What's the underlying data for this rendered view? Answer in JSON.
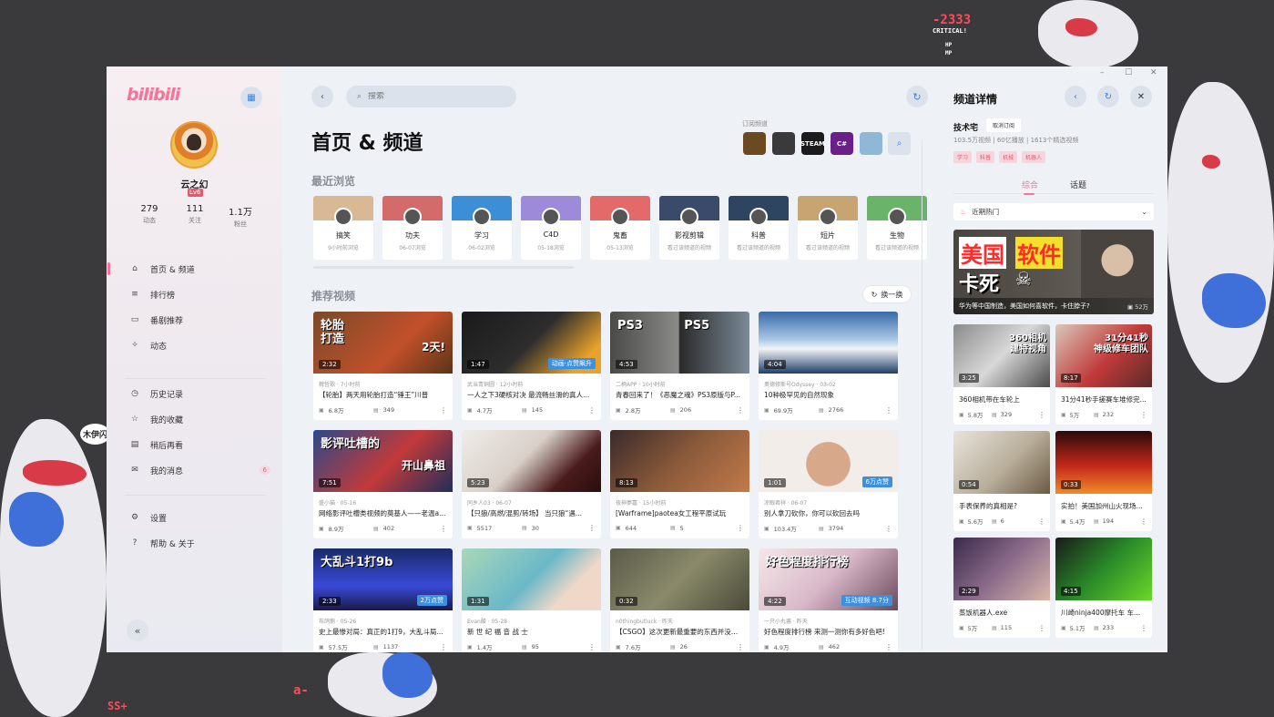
{
  "app": {
    "logo": "bilibili",
    "controls": {
      "min": "–",
      "max": "☐",
      "close": "✕"
    }
  },
  "decor": {
    "critical_num": "-2333",
    "critical_text": "CRITICAL!",
    "hp": "HP",
    "mp": "MP",
    "ss": "SS+",
    "a": "a-",
    "bubble": "木伊闪"
  },
  "sidebar": {
    "user": {
      "name": "云之幻",
      "level": "Lv6"
    },
    "stats": [
      {
        "value": "279",
        "label": "动态"
      },
      {
        "value": "111",
        "label": "关注"
      },
      {
        "value": "1.1万",
        "label": "粉丝"
      }
    ],
    "nav1": [
      {
        "label": "首页 & 频道",
        "icon": "home-icon",
        "glyph": "⌂"
      },
      {
        "label": "排行榜",
        "icon": "rank-icon",
        "glyph": "≡"
      },
      {
        "label": "番剧推荐",
        "icon": "tv-icon",
        "glyph": "▭"
      },
      {
        "label": "动态",
        "icon": "dynamic-icon",
        "glyph": "✧"
      }
    ],
    "nav2": [
      {
        "label": "历史记录",
        "icon": "history-icon",
        "glyph": "◷"
      },
      {
        "label": "我的收藏",
        "icon": "star-icon",
        "glyph": "☆"
      },
      {
        "label": "稍后再看",
        "icon": "later-icon",
        "glyph": "▤"
      },
      {
        "label": "我的消息",
        "icon": "mail-icon",
        "glyph": "✉",
        "badge": "6"
      }
    ],
    "nav3": [
      {
        "label": "设置",
        "icon": "gear-icon",
        "glyph": "⚙"
      },
      {
        "label": "帮助 & 关于",
        "icon": "help-icon",
        "glyph": "?"
      }
    ],
    "collapse": "«"
  },
  "main": {
    "search_placeholder": "搜索",
    "title": "首页 & 频道",
    "subscribed_label": "订阅频道",
    "channels": [
      {
        "icon": "channel-food-icon",
        "color": "#6b4a22",
        "text": ""
      },
      {
        "icon": "channel-game-icon",
        "color": "#3a3a3a",
        "text": ""
      },
      {
        "icon": "channel-steam-icon",
        "color": "#1b1b1b",
        "text": "STEAM"
      },
      {
        "icon": "channel-csharp-icon",
        "color": "#6a1f8a",
        "text": "C#"
      },
      {
        "icon": "channel-tech-icon",
        "color": "#8fb8d8",
        "text": ""
      }
    ],
    "recent_title": "最近浏览",
    "recent": [
      {
        "name": "搞笑",
        "time": "9小时前浏览",
        "color": "#d9b896"
      },
      {
        "name": "功夫",
        "time": "06-07浏览",
        "color": "#d46a6a"
      },
      {
        "name": "学习",
        "time": "06-02浏览",
        "color": "#3c8ed6"
      },
      {
        "name": "C4D",
        "time": "05-18浏览",
        "color": "#9d8ad8"
      },
      {
        "name": "鬼畜",
        "time": "05-13浏览",
        "color": "#e46a6a"
      },
      {
        "name": "影视剪辑",
        "time": "看过该频道的视频",
        "color": "#3a4a6a"
      },
      {
        "name": "科普",
        "time": "看过该频道的视频",
        "color": "#2d4560"
      },
      {
        "name": "短片",
        "time": "看过该频道的视频",
        "color": "#c8a473"
      },
      {
        "name": "生物",
        "time": "看过该频道的视频",
        "color": "#6ab36a"
      }
    ],
    "rec_title": "推荐视频",
    "shuffle": "换一换",
    "videos": [
      {
        "dur": "2:32",
        "tag": "",
        "up": "稗哲歌 · 7小时前",
        "title": "【轮胎】两天用轮胎打造“锤王”川普",
        "views": "6.8万",
        "danmu": "349",
        "bg": "linear-gradient(135deg,#7a4a2a,#c2502a 60%,#5a3418)",
        "ov": "轮胎\n打造",
        "ov2": "2天!"
      },
      {
        "dur": "1:47",
        "tag": "动画·点赞飙升",
        "up": "武当青铜圆 · 12小时前",
        "title": "一人之下3硬核对决 最流畅丝滑的真人...",
        "views": "4.7万",
        "danmu": "145",
        "bg": "linear-gradient(135deg,#1a1a1a,#2d2d2d 50%,#e9a22a 85%)",
        "ov": "",
        "ov2": ""
      },
      {
        "dur": "4:53",
        "tag": "",
        "up": "二柄APP · 10小时前",
        "title": "青春回来了！《恶魔之魂》PS3原版与P...",
        "views": "2.8万",
        "danmu": "206",
        "bg": "linear-gradient(90deg,#4a4a48,#8a8a88 49%,#2a2a2a 50%,#7a8a96)",
        "ov": "PS3          PS5",
        "ov2": ""
      },
      {
        "dur": "4:04",
        "tag": "",
        "up": "奥德修斯号Odyssey · 03-02",
        "title": "10种极罕见的自然现象",
        "views": "69.9万",
        "danmu": "2766",
        "bg": "linear-gradient(180deg,#3a6aa8,#a9c8e6 45%,#f2f4f6 60%,#1e3e6a)",
        "ov": "",
        "ov2": ""
      },
      {
        "dur": "7:51",
        "tag": "",
        "up": "盛小猫 · 05-16",
        "title": "网络影评吐槽类视频的莫基人——老温a...",
        "views": "8.9万",
        "danmu": "402",
        "bg": "linear-gradient(135deg,#2a4a8a,#c23a3a 55%,#1f2e5a)",
        "ov": "影评吐槽的",
        "ov2": "开山鼻祖"
      },
      {
        "dur": "5:23",
        "tag": "",
        "up": "同乡人03 · 06-07",
        "title": "【只狼/高燃/混剪/转场】 当只狼“遇...",
        "views": "5517",
        "danmu": "30",
        "bg": "linear-gradient(135deg,#f0ece8,#d8d0c8 45%,#4a1a1a 75%,#2a0e0e)",
        "ov": "",
        "ov2": ""
      },
      {
        "dur": "8:13",
        "tag": "",
        "up": "夜神夢嘉 · 15小时前",
        "title": "[Warframe]paotea女工程平原试玩",
        "views": "644",
        "danmu": "5",
        "bg": "linear-gradient(135deg,#3a2a2a,#8a5a3a 50%,#c27a4a)",
        "ov": "",
        "ov2": ""
      },
      {
        "dur": "1:01",
        "tag": "6万点赞",
        "up": "凉眼君祥 · 06-07",
        "title": "别人拿刀砍你，你可以砍回去吗",
        "views": "103.4万",
        "danmu": "3794",
        "bg": "radial-gradient(circle at 50% 55%,#d8a88a 0 28%,#f2ede8 29% 100%)",
        "ov": "",
        "ov2": ""
      },
      {
        "dur": "2:33",
        "tag": "2万点赞",
        "up": "布鸽鹅 · 05-26",
        "title": "史上最惨对局：真正的1打9，大乱斗局...",
        "views": "57.5万",
        "danmu": "1137",
        "bg": "linear-gradient(180deg,#1a2a6a,#3a4ad8 60%,#1a1a4a)",
        "ov": "大乱斗1打9b",
        "ov2": ""
      },
      {
        "dur": "1:31",
        "tag": "",
        "up": "Evan酸 · 05-28",
        "title": "新 世 纪 福 音 战 士",
        "views": "1.4万",
        "danmu": "95",
        "bg": "linear-gradient(135deg,#a8d8b8,#6ab8c8 50%,#f0d8c8 75%)",
        "ov": "",
        "ov2": ""
      },
      {
        "dur": "0:32",
        "tag": "",
        "up": "n0thingbutluck · 昨天",
        "title": "【CSGO】这次更新最重要的东西并没有...",
        "views": "7.6万",
        "danmu": "26",
        "bg": "linear-gradient(135deg,#5a5a4a,#8a8a6a 50%,#4a4a3a)",
        "ov": "",
        "ov2": ""
      },
      {
        "dur": "4:22",
        "tag": "互动视频 8.7分",
        "up": "一只小丸酱 · 昨天",
        "title": "好色程度排行榜 来测一测你有多好色吧!",
        "views": "4.9万",
        "danmu": "462",
        "bg": "linear-gradient(135deg,#f4e8e8,#d8b8c8 50%,#6a4a5a)",
        "ov": "好色程度排行榜",
        "ov2": ""
      }
    ]
  },
  "right": {
    "title": "频道详情",
    "channel_name": "技术宅",
    "unsubscribe": "取消订阅",
    "stats": "103.5万视频 | 60亿播放 | 1613个精选视频",
    "tags": [
      "学习",
      "科普",
      "机械",
      "机器人"
    ],
    "tabs": [
      "综合",
      "话题"
    ],
    "select": "近期热门",
    "featured": {
      "title": "华为等中国制造，美国如何喜软件，卡住脖子?",
      "plays": "52万",
      "ov": "美国",
      "ov2": "软件",
      "ov3": "卡死"
    },
    "videos": [
      {
        "dur": "3:25",
        "title": "360相机带在车轮上",
        "views": "5.8万",
        "danmu": "329",
        "bg": "linear-gradient(135deg,#8a8a8a,#d8d8d8 50%,#4a4a4a)",
        "ov": "360相机\n建特视角"
      },
      {
        "dur": "8:17",
        "title": "31分41秒手搓赛车堆修完...",
        "views": "5万",
        "danmu": "232",
        "bg": "linear-gradient(135deg,#d8c8b8,#c23a3a 55%,#5a2a2a)",
        "ov": "31分41秒\n神级修车团队"
      },
      {
        "dur": "0:54",
        "title": "手表保养的真相是?",
        "views": "5.6万",
        "danmu": "6",
        "bg": "linear-gradient(135deg,#e8e4dc,#b8ae9a 55%,#6a5a44)",
        "ov": ""
      },
      {
        "dur": "0:33",
        "title": "实拍！美国加州山火现场...",
        "views": "5.4万",
        "danmu": "194",
        "bg": "linear-gradient(180deg,#2a0a0a,#c2281a 55%,#f28a2a)",
        "ov": ""
      },
      {
        "dur": "2:29",
        "title": "蒸饭机器人.exe",
        "views": "5万",
        "danmu": "115",
        "bg": "linear-gradient(135deg,#3a2a4a,#8a6a8a 50%,#d8b8a8)",
        "ov": ""
      },
      {
        "dur": "4:15",
        "title": "川崎ninja400摩托车 车...",
        "views": "5.1万",
        "danmu": "233",
        "bg": "linear-gradient(135deg,#1a1a1a,#2a8a2a 50%,#6ad82a)",
        "ov": ""
      }
    ]
  }
}
